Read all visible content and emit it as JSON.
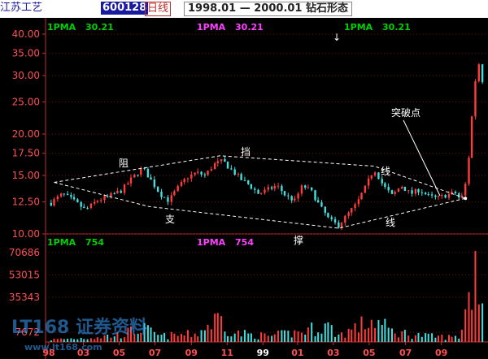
{
  "header": {
    "stock_name": "江苏工艺",
    "stock_code": "600128",
    "period": "日线",
    "date_range": "1998.01 — 2000.01 钻石形态"
  },
  "price_panel": {
    "ma_labels": [
      {
        "name": "1PMA",
        "value": "30.21",
        "color": "#00d000"
      },
      {
        "name": "1PMA",
        "value": "30.21",
        "color": "#ff40ff"
      },
      {
        "name": "1PMA",
        "value": "30.21",
        "color": "#00d000"
      }
    ],
    "arrow": "↓",
    "y_ticks": [
      "40.00",
      "35.00",
      "30.00",
      "25.00",
      "20.00",
      "17.50",
      "15.00",
      "12.50",
      "10.00"
    ],
    "annotations": {
      "resistance_1": "阻",
      "resistance_2": "挡",
      "resistance_3": "线",
      "support_1": "支",
      "support_2": "撑",
      "support_3": "线",
      "breakout": "突破点"
    }
  },
  "volume_panel": {
    "ma_labels": [
      {
        "name": "1PMA",
        "value": "754",
        "color": "#00d000"
      },
      {
        "name": "1PMA",
        "value": "754",
        "color": "#ff40ff"
      }
    ],
    "y_ticks": [
      "70686",
      "53015",
      "35343",
      "7672"
    ]
  },
  "x_ticks": [
    "98",
    "03",
    "05",
    "07",
    "09",
    "11",
    "99",
    "01",
    "03",
    "05",
    "07",
    "09"
  ],
  "watermark": {
    "line1": "LT168 证券资料",
    "line2": "www.lt168.com"
  },
  "colors": {
    "up": "#ff3c3c",
    "down": "#40e0e0",
    "axis": "#c03030",
    "grid": "#7a1010",
    "dashed": "#ffffff",
    "tick_text": "#ff5050"
  },
  "chart_data": {
    "type": "candlestick",
    "title": "1998.01 — 2000.01 钻石形态",
    "ylim": [
      10,
      40
    ],
    "y_scale": "log",
    "x_months": [
      "1998-01",
      "1998-03",
      "1998-05",
      "1998-07",
      "1998-09",
      "1998-11",
      "1999-01",
      "1999-03",
      "1999-05",
      "1999-07",
      "1999-09",
      "1999-11"
    ],
    "price_path": [
      [
        "1998-01-05",
        12.4
      ],
      [
        "1998-01-25",
        13.2
      ],
      [
        "1998-02-15",
        12.5
      ],
      [
        "1998-03-05",
        11.8
      ],
      [
        "1998-03-25",
        12.6
      ],
      [
        "1998-04-15",
        13.0
      ],
      [
        "1998-05-05",
        13.5
      ],
      [
        "1998-05-25",
        14.8
      ],
      [
        "1998-06-10",
        15.8
      ],
      [
        "1998-06-25",
        14.5
      ],
      [
        "1998-07-10",
        13.2
      ],
      [
        "1998-07-25",
        12.6
      ],
      [
        "1998-08-10",
        13.8
      ],
      [
        "1998-08-25",
        14.8
      ],
      [
        "1998-09-10",
        15.3
      ],
      [
        "1998-09-25",
        15.0
      ],
      [
        "1998-10-10",
        16.2
      ],
      [
        "1998-10-25",
        16.6
      ],
      [
        "1998-11-10",
        15.5
      ],
      [
        "1998-11-25",
        14.6
      ],
      [
        "1998-12-10",
        14.0
      ],
      [
        "1998-12-25",
        13.2
      ],
      [
        "1999-01-10",
        13.6
      ],
      [
        "1999-01-25",
        14.0
      ],
      [
        "1999-02-10",
        13.0
      ],
      [
        "1999-02-25",
        12.6
      ],
      [
        "1999-03-10",
        14.0
      ],
      [
        "1999-03-25",
        13.4
      ],
      [
        "1999-04-10",
        12.0
      ],
      [
        "1999-04-25",
        11.0
      ],
      [
        "1999-05-10",
        10.6
      ],
      [
        "1999-05-25",
        11.4
      ],
      [
        "1999-06-10",
        12.3
      ],
      [
        "1999-06-25",
        13.8
      ],
      [
        "1999-07-10",
        15.7
      ],
      [
        "1999-07-25",
        14.0
      ],
      [
        "1999-08-10",
        13.0
      ],
      [
        "1999-08-25",
        14.0
      ],
      [
        "1999-09-10",
        13.2
      ],
      [
        "1999-09-25",
        13.6
      ],
      [
        "1999-10-10",
        13.0
      ],
      [
        "1999-10-25",
        12.8
      ],
      [
        "1999-11-10",
        13.1
      ],
      [
        "1999-11-25",
        13.3
      ],
      [
        "1999-12-05",
        12.6
      ],
      [
        "1999-12-15",
        14.6
      ],
      [
        "1999-12-22",
        20.0
      ],
      [
        "1999-12-28",
        28.0
      ],
      [
        "2000-01-05",
        33.0
      ],
      [
        "2000-01-10",
        29.0
      ]
    ],
    "volume_path": [
      [
        "1998-01-05",
        2000
      ],
      [
        "1998-03-01",
        3500
      ],
      [
        "1998-05-01",
        6000
      ],
      [
        "1998-06-10",
        12000
      ],
      [
        "1998-07-10",
        5000
      ],
      [
        "1998-09-10",
        7000
      ],
      [
        "1998-10-20",
        22000
      ],
      [
        "1998-11-10",
        8000
      ],
      [
        "1999-01-10",
        5000
      ],
      [
        "1999-03-10",
        9000
      ],
      [
        "1999-04-20",
        15000
      ],
      [
        "1999-05-10",
        6000
      ],
      [
        "1999-07-10",
        19000
      ],
      [
        "1999-08-10",
        9000
      ],
      [
        "1999-10-10",
        5000
      ],
      [
        "1999-12-01",
        4000
      ],
      [
        "1999-12-22",
        45000
      ],
      [
        "1999-12-28",
        70000
      ],
      [
        "2000-01-05",
        60000
      ],
      [
        "2000-01-10",
        40000
      ]
    ],
    "resistance_line": [
      [
        "1998-01-10",
        14.3
      ],
      [
        "1998-10-20",
        17.2
      ],
      [
        "1999-07-10",
        16.0
      ],
      [
        "1999-12-12",
        12.8
      ]
    ],
    "support_line": [
      [
        "1998-01-10",
        14.3
      ],
      [
        "1998-06-20",
        12.1
      ],
      [
        "1999-05-10",
        10.4
      ],
      [
        "1999-12-12",
        12.8
      ]
    ],
    "breakout_point": [
      "1999-12-12",
      12.8
    ]
  }
}
